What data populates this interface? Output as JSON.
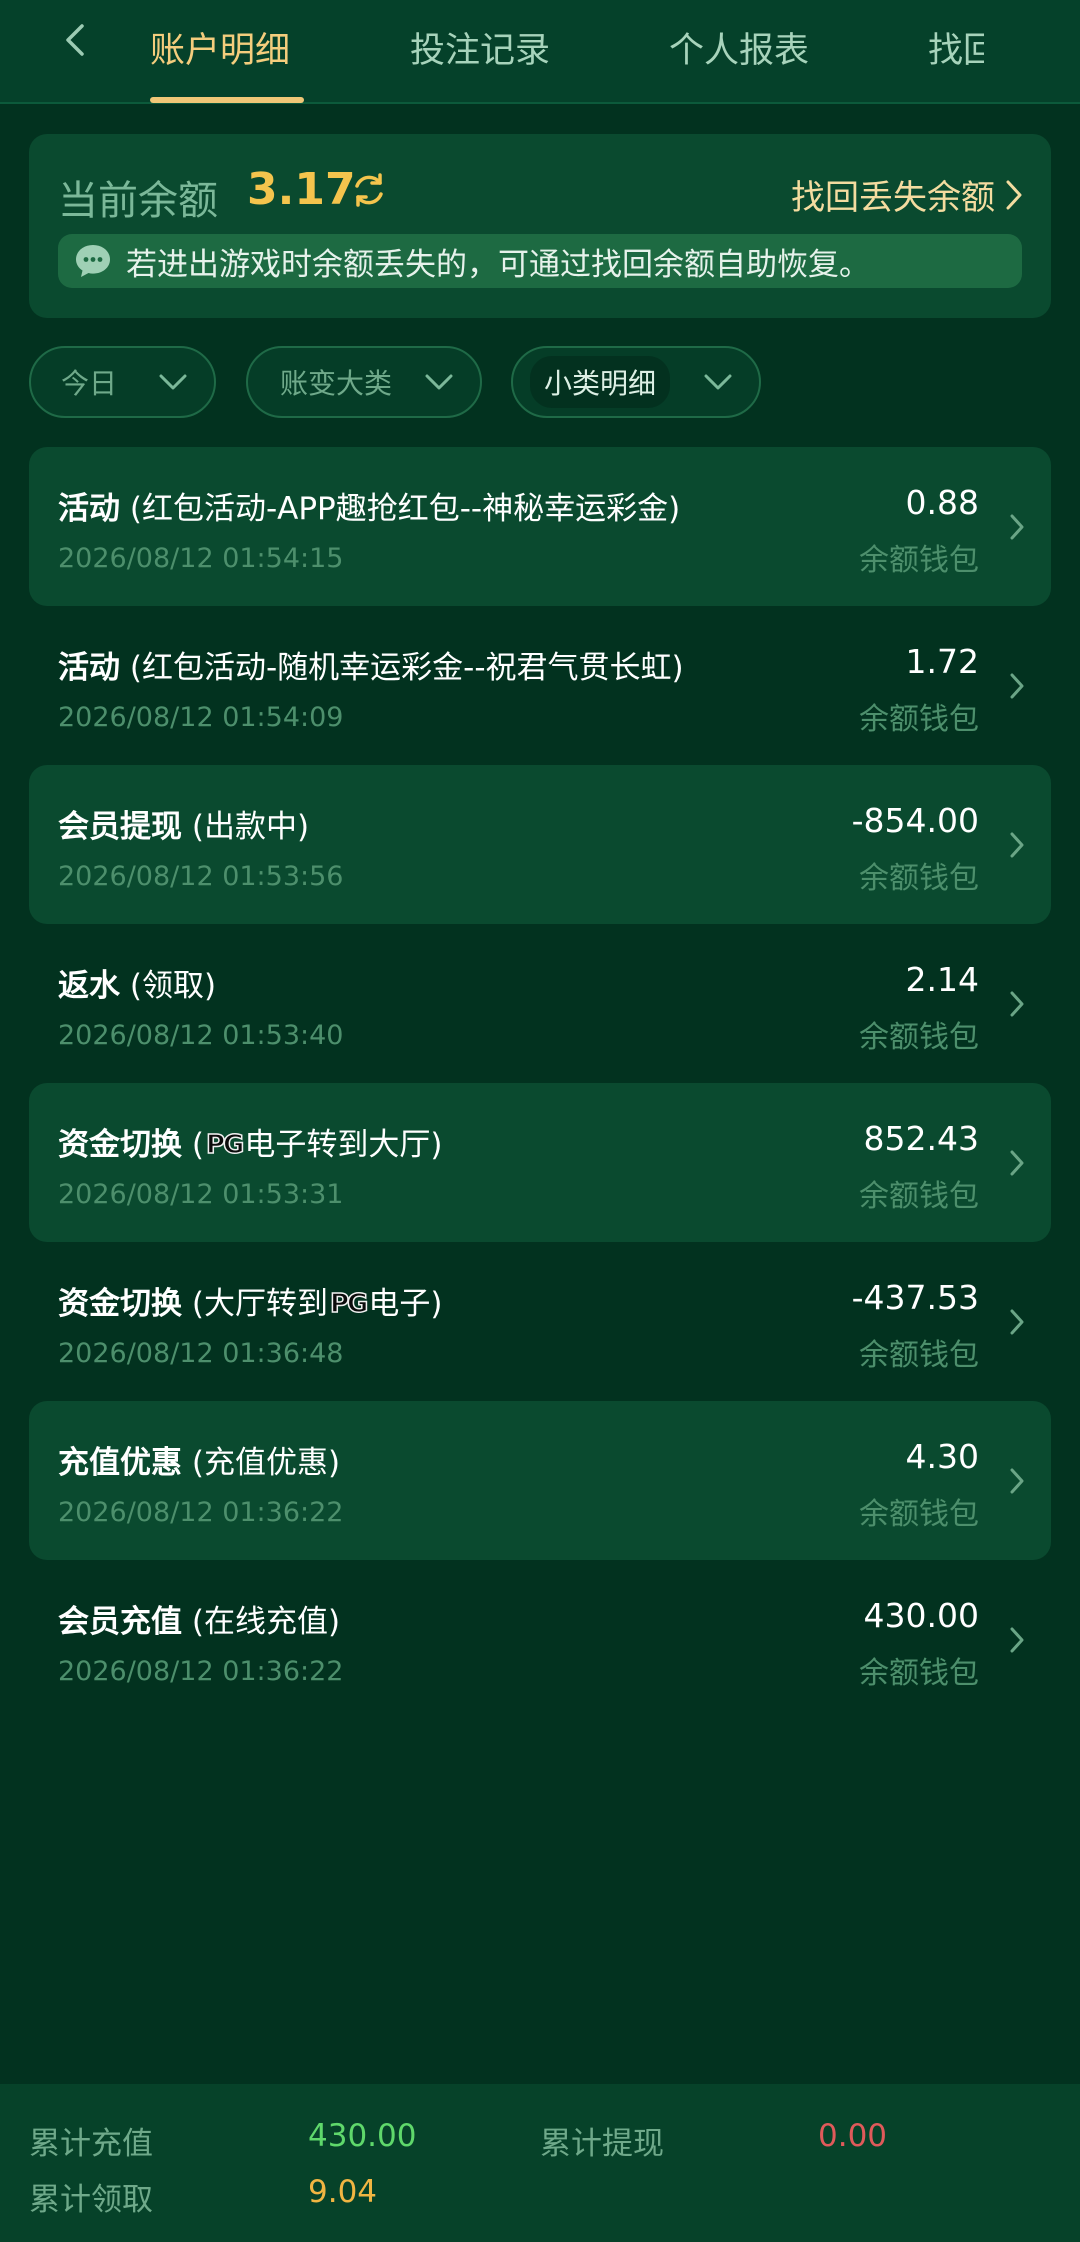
{
  "tabs": [
    {
      "label": "账户明细",
      "active": true
    },
    {
      "label": "投注记录",
      "active": false
    },
    {
      "label": "个人报表",
      "active": false
    },
    {
      "label": "找回",
      "active": false
    }
  ],
  "balance": {
    "label": "当前余额",
    "value": "3.17",
    "recover_link": "找回丢失余额",
    "notice": "若进出游戏时余额丢失的，可通过找回余额自助恢复。"
  },
  "filters": [
    {
      "label": "今日",
      "selected": false
    },
    {
      "label": "账变大类",
      "selected": false
    },
    {
      "label": "小类明细",
      "selected": true
    }
  ],
  "transactions": [
    {
      "category": "活动",
      "detail_before": " (红包活动-APP趣抢红包--神秘幸运彩金)",
      "logo": "",
      "detail_after": "",
      "datetime": "2026/08/12 01:54:15",
      "amount": "0.88",
      "wallet": "余额钱包"
    },
    {
      "category": "活动",
      "detail_before": " (红包活动-随机幸运彩金--祝君气贯长虹)",
      "logo": "",
      "detail_after": "",
      "datetime": "2026/08/12 01:54:09",
      "amount": "1.72",
      "wallet": "余额钱包"
    },
    {
      "category": "会员提现",
      "detail_before": " (出款中)",
      "logo": "",
      "detail_after": "",
      "datetime": "2026/08/12 01:53:56",
      "amount": "-854.00",
      "wallet": "余额钱包"
    },
    {
      "category": "返水",
      "detail_before": " (领取)",
      "logo": "",
      "detail_after": "",
      "datetime": "2026/08/12 01:53:40",
      "amount": "2.14",
      "wallet": "余额钱包"
    },
    {
      "category": "资金切换",
      "detail_before": " (",
      "logo": "PG",
      "detail_after": "电子转到大厅)",
      "datetime": "2026/08/12 01:53:31",
      "amount": "852.43",
      "wallet": "余额钱包"
    },
    {
      "category": "资金切换",
      "detail_before": " (大厅转到",
      "logo": "PG",
      "detail_after": "电子)",
      "datetime": "2026/08/12 01:36:48",
      "amount": "-437.53",
      "wallet": "余额钱包"
    },
    {
      "category": "充值优惠",
      "detail_before": " (充值优惠)",
      "logo": "",
      "detail_after": "",
      "datetime": "2026/08/12 01:36:22",
      "amount": "4.30",
      "wallet": "余额钱包"
    },
    {
      "category": "会员充值",
      "detail_before": " (在线充值)",
      "logo": "",
      "detail_after": "",
      "datetime": "2026/08/12 01:36:22",
      "amount": "430.00",
      "wallet": "余额钱包"
    }
  ],
  "summary": {
    "total_deposit_label": "累计充值",
    "total_deposit_value": "430.00",
    "total_withdraw_label": "累计提现",
    "total_withdraw_value": "0.00",
    "total_claim_label": "累计领取",
    "total_claim_value": "9.04"
  },
  "colors": {
    "background": "#02321f",
    "accent": "#f4cd7d",
    "balance": "#f4c44d",
    "deposit": "#5fd86b",
    "withdraw": "#e05a5a",
    "claim": "#f1b542"
  },
  "icons": [
    "back-chevron-icon",
    "refresh-icon",
    "chevron-right-icon",
    "chat-bubble-icon",
    "chevron-down-icon"
  ]
}
